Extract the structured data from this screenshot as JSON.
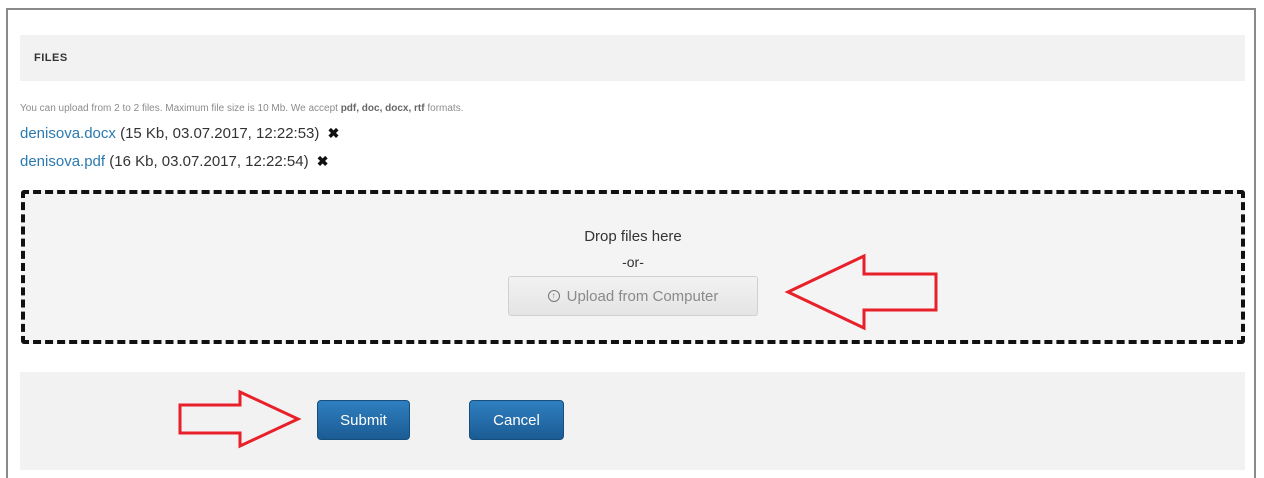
{
  "section": {
    "title": "FILES"
  },
  "hint": {
    "prefix": "You can upload from 2 to 2 files. Maximum file size is 10 Mb. We accept ",
    "formats": "pdf, doc, docx, rtf",
    "suffix": " formats."
  },
  "files": [
    {
      "name": "denisova.docx",
      "meta": " (15 Kb, 03.07.2017, 12:22:53)",
      "remove_icon": "close-icon"
    },
    {
      "name": "denisova.pdf",
      "meta": " (16 Kb, 03.07.2017, 12:22:54)",
      "remove_icon": "close-icon"
    }
  ],
  "dropzone": {
    "text": "Drop files here",
    "or": "-or-",
    "upload_label": "Upload from Computer",
    "upload_icon": "upload-circle-icon"
  },
  "actions": {
    "submit_label": "Submit",
    "cancel_label": "Cancel"
  },
  "colors": {
    "link": "#2a7ab0",
    "primary_button": "#1f6aa8",
    "annotation_arrow": "#e8202a"
  }
}
